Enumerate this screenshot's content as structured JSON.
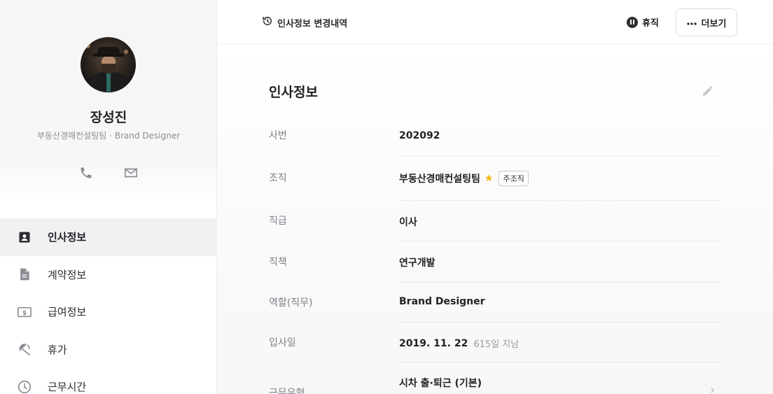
{
  "profile": {
    "name": "장성진",
    "subtitle": "부동산경매컨설팅팀 · Brand Designer",
    "icons": [
      "phone-icon",
      "mail-icon"
    ]
  },
  "nav": {
    "items": [
      {
        "label": "인사정보",
        "icon": "id-card-icon",
        "active": true
      },
      {
        "label": "계약정보",
        "icon": "document-icon",
        "active": false
      },
      {
        "label": "급여정보",
        "icon": "money-icon",
        "active": false
      },
      {
        "label": "휴가",
        "icon": "umbrella-icon",
        "active": false
      },
      {
        "label": "근무시간",
        "icon": "clock-icon",
        "active": false
      }
    ]
  },
  "topbar": {
    "history_label": "인사정보 변경내역",
    "leave_label": "휴직",
    "more_label": "더보기"
  },
  "section": {
    "title": "인사정보",
    "rows": [
      {
        "label": "사번",
        "value": "202092"
      },
      {
        "label": "조직",
        "value": "부동산경매컨설팅팀",
        "badge": "주조직",
        "starred": true
      },
      {
        "label": "직급",
        "value": "이사"
      },
      {
        "label": "직책",
        "value": "연구개발"
      },
      {
        "label": "역할(직무)",
        "value": "Brand Designer"
      },
      {
        "label": "입사일",
        "value": "2019. 11. 22",
        "extra": "615일 지남"
      },
      {
        "label": "근무유형",
        "value": "시차 출·퇴근 (기본)"
      }
    ]
  },
  "colors": {
    "accent_underline": "#f8d86a",
    "star": "#f4b400",
    "text": "#1f2124",
    "muted": "#7d8086"
  }
}
